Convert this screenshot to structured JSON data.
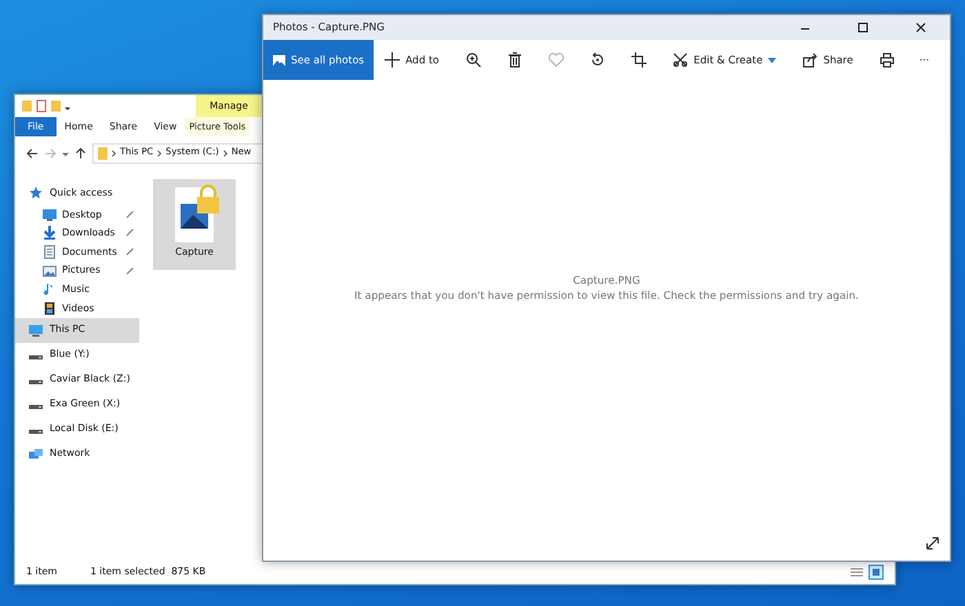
{
  "explorer": {
    "context_tab": "Manage",
    "ribbon_tabs": [
      {
        "label": "File",
        "kind": "file"
      },
      {
        "label": "Home",
        "kind": "tab"
      },
      {
        "label": "Share",
        "kind": "tab"
      },
      {
        "label": "View",
        "kind": "tab"
      },
      {
        "label": "Picture Tools",
        "kind": "context"
      }
    ],
    "breadcrumb": [
      "This PC",
      "System (C:)",
      "New"
    ],
    "nav": [
      {
        "label": "Quick access",
        "kind": "star",
        "selected": false,
        "children": [
          {
            "label": "Desktop",
            "kind": "desktop",
            "pinned": true,
            "selected": false
          },
          {
            "label": "Downloads",
            "kind": "download",
            "pinned": true,
            "selected": false
          },
          {
            "label": "Documents",
            "kind": "document",
            "pinned": true,
            "selected": false
          },
          {
            "label": "Pictures",
            "kind": "pictures",
            "pinned": true,
            "selected": false
          },
          {
            "label": "Music",
            "kind": "music",
            "pinned": false,
            "selected": false
          },
          {
            "label": "Videos",
            "kind": "videos",
            "pinned": false,
            "selected": false
          }
        ]
      },
      {
        "label": "This PC",
        "kind": "pc",
        "selected": true
      },
      {
        "label": "Blue (Y:)",
        "kind": "drive",
        "selected": false
      },
      {
        "label": "Caviar Black (Z:)",
        "kind": "drive",
        "selected": false
      },
      {
        "label": "Exa Green (X:)",
        "kind": "drive",
        "selected": false
      },
      {
        "label": "Local Disk (E:)",
        "kind": "drive",
        "selected": false
      },
      {
        "label": "Network",
        "kind": "network",
        "selected": false
      }
    ],
    "files": [
      {
        "name": "Capture",
        "selected": true,
        "locked": true
      }
    ],
    "status": [
      "1 item",
      "1 item selected  875 KB"
    ]
  },
  "photos": {
    "title": "Photos - Capture.PNG",
    "see_all": {
      "label": "See all photos",
      "selected": true
    },
    "toolbar": [
      {
        "kind": "add",
        "label": "Add to",
        "disabled": false
      },
      {
        "kind": "zoom",
        "disabled": false
      },
      {
        "kind": "trash",
        "disabled": false
      },
      {
        "kind": "heart",
        "disabled": true
      },
      {
        "kind": "rotate",
        "disabled": false
      },
      {
        "kind": "crop",
        "disabled": false
      },
      {
        "kind": "edit",
        "label": "Edit & Create",
        "disabled": false
      },
      {
        "kind": "share",
        "label": "Share",
        "disabled": false
      },
      {
        "kind": "print",
        "disabled": false
      },
      {
        "kind": "more",
        "label": "···",
        "disabled": false
      }
    ],
    "file_name": "Capture.PNG",
    "message": "It appears that you don't have permission to view this file. Check the permissions and try again."
  }
}
